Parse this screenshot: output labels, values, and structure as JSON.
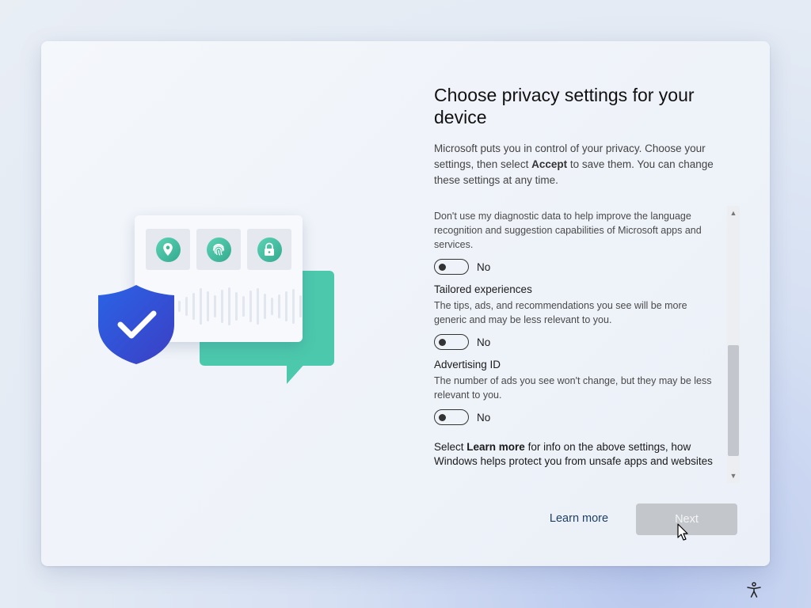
{
  "page": {
    "title": "Choose privacy settings for your device",
    "intro_parts": [
      "Microsoft puts you in control of your privacy. Choose your settings, then select ",
      "Accept",
      " to save them. You can change these settings at any time."
    ]
  },
  "settings": [
    {
      "title": "",
      "description": "Don't use my diagnostic data to help improve the language recognition and suggestion capabilities of Microsoft apps and services.",
      "toggle_state": "No"
    },
    {
      "title": "Tailored experiences",
      "description": "The tips, ads, and recommendations you see will be more generic and may be less relevant to you.",
      "toggle_state": "No"
    },
    {
      "title": "Advertising ID",
      "description": "The number of ads you see won't change, but they may be less relevant to you.",
      "toggle_state": "No"
    }
  ],
  "footer_text": {
    "prefix": "Select ",
    "bold": "Learn more",
    "suffix": " for info on the above settings, how Windows helps protect you from unsafe apps and websites"
  },
  "scrollbar": {
    "up_glyph": "▲",
    "down_glyph": "▼"
  },
  "buttons": {
    "learn_more": "Learn more",
    "next": "Next"
  },
  "colors": {
    "accent_teal": "#4cc9ad",
    "shield_blue": "#2f5fdc",
    "button_disabled": "#c3c6cb",
    "link": "#1d3f66"
  },
  "icons": [
    "location-pin-icon",
    "fingerprint-icon",
    "lock-icon",
    "shield-check-icon",
    "accessibility-icon",
    "mouse-cursor-icon"
  ]
}
